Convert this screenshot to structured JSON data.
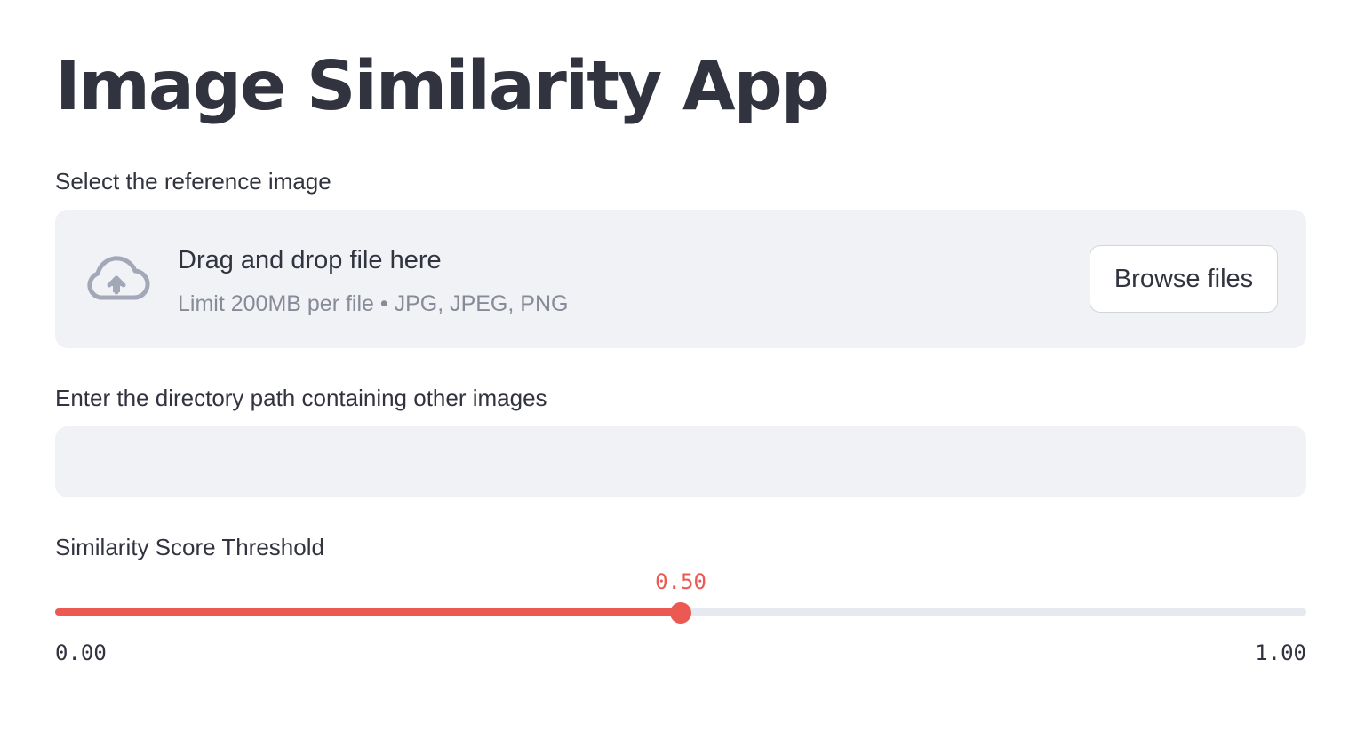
{
  "page": {
    "title": "Image Similarity App"
  },
  "uploader": {
    "label": "Select the reference image",
    "drop_text": "Drag and drop file here",
    "limits_text": "Limit 200MB per file • JPG, JPEG, PNG",
    "browse_label": "Browse files",
    "icon": "cloud-upload-icon"
  },
  "directory": {
    "label": "Enter the directory path containing other images",
    "value": "",
    "placeholder": ""
  },
  "slider": {
    "label": "Similarity Score Threshold",
    "value": 0.5,
    "value_text": "0.50",
    "min": 0,
    "max": 1,
    "min_text": "0.00",
    "max_text": "1.00"
  },
  "colors": {
    "accent": "#ec5953",
    "text": "#31333f",
    "muted": "#878b97",
    "panel": "#f0f2f6",
    "icon": "#a3a8b8"
  }
}
